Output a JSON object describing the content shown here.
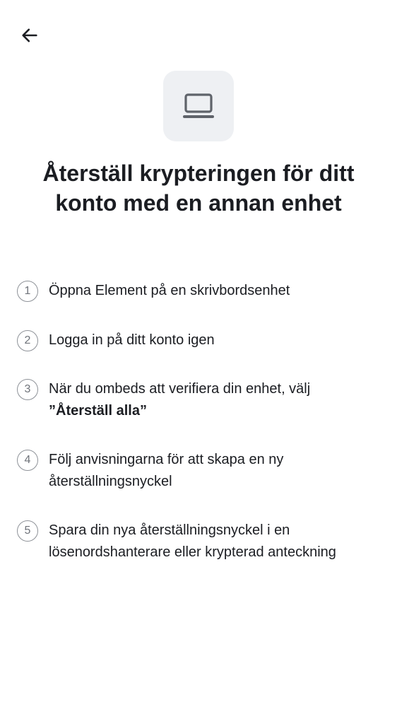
{
  "header": {
    "back_icon": "arrow-left-icon"
  },
  "hero": {
    "icon": "laptop-icon",
    "icon_box_color": "#eef0f3"
  },
  "title": "Återställ krypteringen för ditt konto med en annan enhet",
  "steps": [
    {
      "number": "1",
      "text": "Öppna Element på en skrivbordsenhet"
    },
    {
      "number": "2",
      "text": "Logga in på ditt konto igen"
    },
    {
      "number": "3",
      "text": "När du ombeds att verifiera din enhet, välj",
      "emphasis": "”Återställ alla”"
    },
    {
      "number": "4",
      "text": "Följ anvisningarna för att skapa en ny återställningsnyckel"
    },
    {
      "number": "5",
      "text": "Spara din nya återställningsnyckel i en lösenordshanterare eller krypterad anteckning"
    }
  ]
}
